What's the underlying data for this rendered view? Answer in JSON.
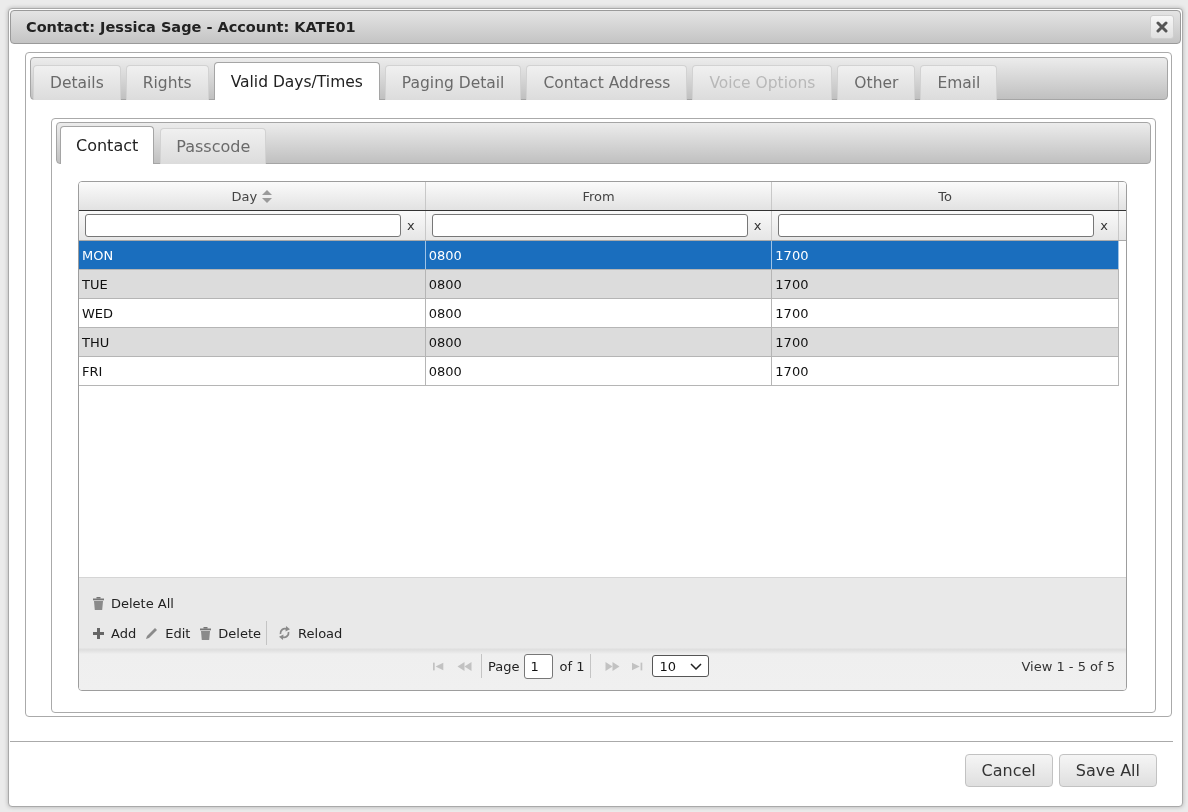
{
  "window": {
    "title": "Contact: Jessica Sage - Account: KATE01"
  },
  "tabs": [
    {
      "label": "Details",
      "selected": false,
      "disabled": false
    },
    {
      "label": "Rights",
      "selected": false,
      "disabled": false
    },
    {
      "label": "Valid Days/Times",
      "selected": true,
      "disabled": false
    },
    {
      "label": "Paging Detail",
      "selected": false,
      "disabled": false
    },
    {
      "label": "Contact Address",
      "selected": false,
      "disabled": false
    },
    {
      "label": "Voice Options",
      "selected": false,
      "disabled": true
    },
    {
      "label": "Other",
      "selected": false,
      "disabled": false
    },
    {
      "label": "Email",
      "selected": false,
      "disabled": false
    }
  ],
  "sub_tabs": [
    {
      "label": "Contact",
      "selected": true
    },
    {
      "label": "Passcode",
      "selected": false
    }
  ],
  "grid": {
    "columns": [
      {
        "title": "Day",
        "sortable": true,
        "clear": "x"
      },
      {
        "title": "From",
        "sortable": false,
        "clear": "x"
      },
      {
        "title": "To",
        "sortable": false,
        "clear": "x"
      }
    ],
    "rows": [
      {
        "cells": [
          "MON",
          "0800",
          "1700"
        ],
        "selected": true
      },
      {
        "cells": [
          "TUE",
          "0800",
          "1700"
        ],
        "selected": false
      },
      {
        "cells": [
          "WED",
          "0800",
          "1700"
        ],
        "selected": false
      },
      {
        "cells": [
          "THU",
          "0800",
          "1700"
        ],
        "selected": false
      },
      {
        "cells": [
          "FRI",
          "0800",
          "1700"
        ],
        "selected": false
      }
    ],
    "toolbars": [
      {
        "groups": [
          {
            "buttons": [
              {
                "label": "Delete All",
                "kind": "trash"
              }
            ]
          }
        ]
      },
      {
        "groups": [
          {
            "buttons": [
              {
                "label": "Add",
                "kind": "plus"
              },
              {
                "label": "Edit",
                "kind": "pencil"
              },
              {
                "label": "Delete",
                "kind": "trash"
              }
            ]
          },
          {
            "buttons": [
              {
                "label": "Reload",
                "kind": "refresh"
              }
            ]
          }
        ]
      }
    ],
    "pager": {
      "nav_before": [
        {
          "kind": "first",
          "disabled": true
        },
        {
          "kind": "prev",
          "disabled": true
        }
      ],
      "page_label": "Page",
      "page": "1",
      "total_label": "of 1",
      "nav_after": [
        {
          "kind": "next",
          "disabled": true
        },
        {
          "kind": "last",
          "disabled": true
        }
      ],
      "page_size": "10",
      "summary": "View 1 - 5 of 5"
    }
  },
  "buttons": [
    {
      "label": "Cancel"
    },
    {
      "label": "Save All"
    }
  ]
}
